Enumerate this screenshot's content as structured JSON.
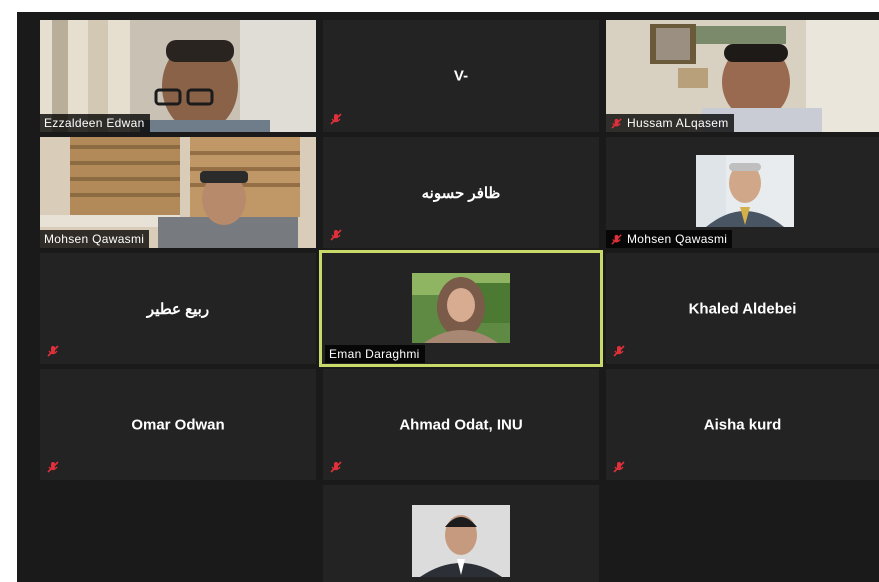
{
  "participants": [
    {
      "name": "Ezzaldeen Edwan",
      "muted": false,
      "video": true
    },
    {
      "name": "V-",
      "muted": true,
      "video": false
    },
    {
      "name": "Hussam ALqasem",
      "muted": true,
      "video": true
    },
    {
      "name": "Mohsen Qawasmi",
      "muted": false,
      "video": true
    },
    {
      "name": "ظافر حسونه",
      "muted": true,
      "video": false
    },
    {
      "name": "Mohsen Qawasmi",
      "muted": true,
      "video": true
    },
    {
      "name": "ربيع عطير",
      "muted": true,
      "video": false
    },
    {
      "name": "Eman Daraghmi",
      "muted": false,
      "video": true,
      "active_speaker": true
    },
    {
      "name": "Khaled Aldebei",
      "muted": true,
      "video": false
    },
    {
      "name": "Omar Odwan",
      "muted": true,
      "video": false
    },
    {
      "name": "Ahmad Odat, INU",
      "muted": true,
      "video": false
    },
    {
      "name": "Aisha kurd",
      "muted": true,
      "video": false
    },
    {
      "name": "",
      "muted": false,
      "video": true
    }
  ],
  "colors": {
    "active_speaker_border": "#c9d96a",
    "muted_icon": "#e0303a",
    "tile_background": "#232323"
  },
  "icons": {
    "muted": "mic-off-icon"
  }
}
